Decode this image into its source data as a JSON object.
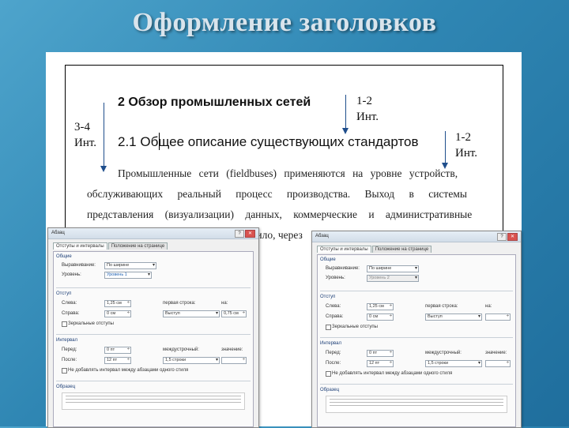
{
  "slide": {
    "title": "Оформление заголовков"
  },
  "document": {
    "heading1": "2 Обзор промышленных сетей",
    "heading2": "2.1 Общее описание существующих стандартов",
    "paragraph_lines": [
      "Промышленные сети (fieldbuses) применяются на уровне устройств,",
      "обслуживающих реальный процесс производства. Выход в системы",
      "представления (визуализации) данных, коммерческие и административные",
      "вило, через"
    ]
  },
  "annotations": {
    "left": {
      "line1": "3-4",
      "line2": "Инт."
    },
    "mid": {
      "line1": "1-2",
      "line2": "Инт."
    },
    "right": {
      "line1": "1-2",
      "line2": "Инт."
    }
  },
  "dialogs": [
    {
      "title": "Абзац",
      "tabs": [
        "Отступы и интервалы",
        "Положение на странице"
      ],
      "general_label": "Общие",
      "alignment_label": "Выравнивание:",
      "alignment_value": "По ширине",
      "level_label": "Уровень:",
      "level_value": "Уровень 1",
      "indent_label": "Отступ",
      "left_label": "Слева:",
      "left_value": "1,25 см",
      "right_label": "Справа:",
      "right_value": "0 см",
      "first_line_label": "первая строка:",
      "first_line_value": "Выступ",
      "by_label": "на:",
      "by_value": "0,75 см",
      "mirror_label": "Зеркальные отступы",
      "spacing_label": "Интервал",
      "before_label": "Перед:",
      "before_value": "0 пт",
      "after_label": "После:",
      "after_value": "12 пт",
      "line_spacing_label": "междустрочный:",
      "line_spacing_value": "1,5 строки",
      "value_label": "значение:",
      "no_space_label": "Не добавлять интервал между абзацами одного стиля",
      "sample_label": "Образец"
    },
    {
      "title": "Абзац",
      "tabs": [
        "Отступы и интервалы",
        "Положение на странице"
      ],
      "general_label": "Общие",
      "alignment_label": "Выравнивание:",
      "alignment_value": "По ширине",
      "level_label": "Уровень:",
      "level_value": "Уровень 2",
      "indent_label": "Отступ",
      "left_label": "Слева:",
      "left_value": "1,25 см",
      "right_label": "Справа:",
      "right_value": "0 см",
      "first_line_label": "первая строка:",
      "first_line_value": "Выступ",
      "by_label": "на:",
      "by_value": "",
      "mirror_label": "Зеркальные отступы",
      "spacing_label": "Интервал",
      "before_label": "Перед:",
      "before_value": "0 пт",
      "after_label": "После:",
      "after_value": "12 пт",
      "line_spacing_label": "междустрочный:",
      "line_spacing_value": "1,5 строки",
      "value_label": "значение:",
      "no_space_label": "Не добавлять интервал между абзацами одного стиля",
      "sample_label": "Образец"
    }
  ],
  "colors": {
    "background": "#2f86b3",
    "arrow": "#1f4e8c",
    "title": "#d9e4ec"
  }
}
